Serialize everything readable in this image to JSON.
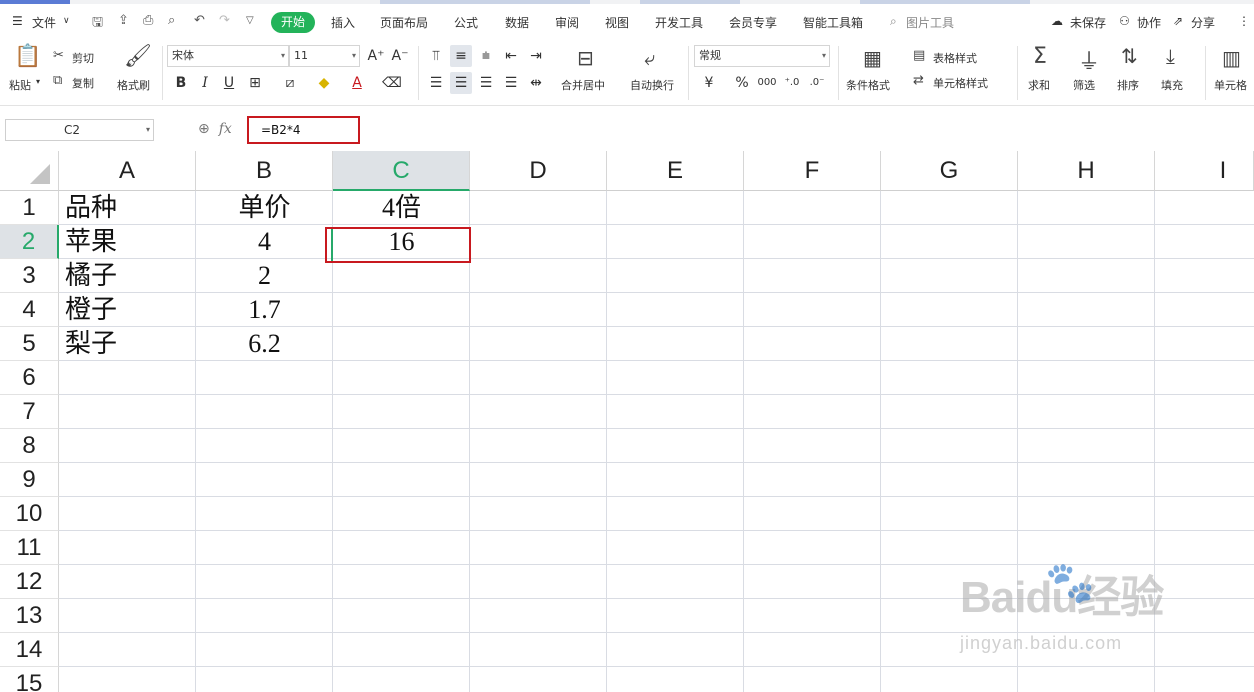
{
  "menubar": {
    "file": "文件",
    "tabs": [
      "开始",
      "插入",
      "页面布局",
      "公式",
      "数据",
      "审阅",
      "视图",
      "开发工具",
      "会员专享",
      "智能工具箱"
    ],
    "picture_tool": "图片工具",
    "unsaved": "未保存",
    "collaborate": "协作",
    "share": "分享"
  },
  "ribbon": {
    "paste": "粘贴",
    "cut": "剪切",
    "copy": "复制",
    "format_painter": "格式刷",
    "font_name": "宋体",
    "font_size": "11",
    "bold": "B",
    "italic": "I",
    "underline": "U",
    "merge_center": "合并居中",
    "wrap_text": "自动换行",
    "number_format": "常规",
    "conditional_format": "条件格式",
    "table_style": "表格样式",
    "cell_style": "单元格样式",
    "sum": "求和",
    "filter": "筛选",
    "sort": "排序",
    "fill": "填充",
    "cell": "单元格"
  },
  "formula_bar": {
    "name_box": "C2",
    "fx": "fx",
    "formula": "=B2*4"
  },
  "sheet": {
    "columns": [
      "A",
      "B",
      "C",
      "D",
      "E",
      "F",
      "G",
      "H",
      "I"
    ],
    "selected_column": "C",
    "rows": [
      "1",
      "2",
      "3",
      "4",
      "5",
      "6",
      "7",
      "8",
      "9",
      "10",
      "11",
      "12",
      "13",
      "14",
      "15"
    ],
    "selected_row": "2",
    "cells": {
      "A1": "品种",
      "B1": "单价",
      "C1": "4倍",
      "A2": "苹果",
      "B2": "4",
      "C2": "16",
      "A3": "橘子",
      "B3": "2",
      "A4": "橙子",
      "B4": "1.7",
      "A5": "梨子",
      "B5": "6.2"
    }
  },
  "watermark": {
    "brand": "Baidu经验",
    "url": "jingyan.baidu.com"
  },
  "colors": {
    "accent_green": "#23b35a",
    "highlight_red": "#c8191f",
    "header_selected": "#dee2e6"
  }
}
